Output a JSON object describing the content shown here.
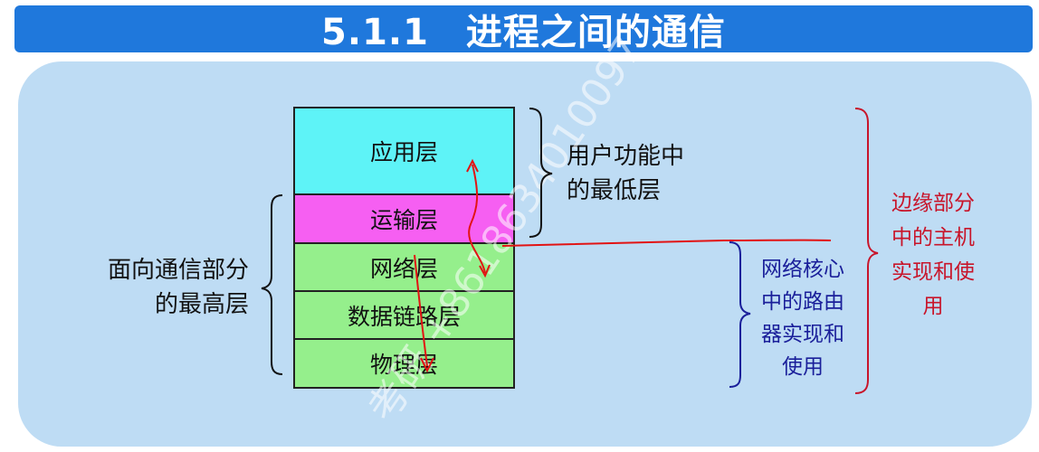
{
  "title": "5.1.1　进程之间的通信",
  "layers": [
    {
      "name": "应用层",
      "color": "#5ef3f7"
    },
    {
      "name": "运输层",
      "color": "#f65ff2"
    },
    {
      "name": "网络层",
      "color": "#95ef8c"
    },
    {
      "name": "数据链路层",
      "color": "#95ef8c"
    },
    {
      "name": "物理层",
      "color": "#95ef8c"
    }
  ],
  "labels": {
    "user_func_line1": "用户功能中",
    "user_func_line2": "的最低层",
    "comm_line1": "面向通信部分",
    "comm_line2": "的最高层",
    "core_line1": "网络核心",
    "core_line2": "中的路由",
    "core_line3": "器实现和",
    "core_line4": "使用",
    "edge_line1": "边缘部分",
    "edge_line2": "中的主机",
    "edge_line3": "实现和使",
    "edge_line4": "用"
  },
  "watermark": "考研 +8618634010097",
  "colors": {
    "title_bg": "#1f78dc",
    "panel_bg": "#bedcf4",
    "annotation_red": "#e21313",
    "core_blue": "#1a1f9a",
    "edge_red": "#c8152a"
  }
}
